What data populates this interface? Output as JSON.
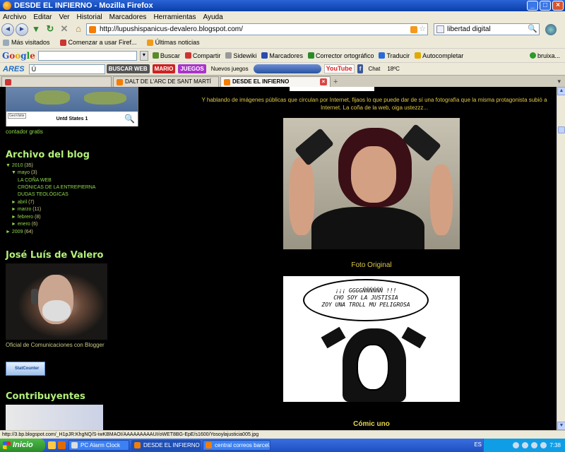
{
  "window": {
    "title": "DESDE EL INFIERNO - Mozilla Firefox",
    "buttons": {
      "minimize": "_",
      "maximize": "□",
      "close": "×"
    }
  },
  "menu": [
    "Archivo",
    "Editar",
    "Ver",
    "Historial",
    "Marcadores",
    "Herramientas",
    "Ayuda"
  ],
  "navigation": {
    "url": "http://lupushispanicus-devalero.blogspot.com/",
    "search_value": "libertad digital"
  },
  "bookmarks": [
    "Más visitados",
    "Comenzar a usar Firef...",
    "Últimas noticias"
  ],
  "google_toolbar": {
    "logo": "Google",
    "items": [
      "Buscar",
      "Compartir",
      "Sidewiki",
      "Marcadores",
      "Corrector ortográfico",
      "Traducir",
      "Autocompletar"
    ],
    "user": "bruixa..."
  },
  "ares_toolbar": {
    "logo": "ARES",
    "input": "Ú",
    "buttons": [
      "BUSCAR WEB",
      "MARIO",
      "JUEGOS",
      "Nuevos juegos"
    ],
    "chat": "Chat",
    "temp": "18ºC",
    "youtube": "YouTube"
  },
  "tabs": [
    {
      "label": "",
      "active": false
    },
    {
      "label": "DALT DE L'ARC DE SANT MARTÍ",
      "active": false
    },
    {
      "label": "DESDE EL INFIERNO",
      "active": true
    }
  ],
  "sidebar": {
    "map_label": "Untd States 1",
    "geovisite": "GeoVisite",
    "contador": "contador gratis",
    "archive_heading": "Archivo del blog",
    "archive": [
      {
        "toggle": "▼",
        "label": "2010",
        "count": "(35)",
        "level": 0
      },
      {
        "toggle": "▼",
        "label": "mayo",
        "count": "(3)",
        "level": 1
      },
      {
        "toggle": "",
        "label": "LA COÑA WEB",
        "count": "",
        "level": 2
      },
      {
        "toggle": "",
        "label": "CRÓNICAS DE LA ENTREPIERNA",
        "count": "",
        "level": 2
      },
      {
        "toggle": "",
        "label": "DUDAS TEOLÓGICAS",
        "count": "",
        "level": 2
      },
      {
        "toggle": "►",
        "label": "abril",
        "count": "(7)",
        "level": 1
      },
      {
        "toggle": "►",
        "label": "marzo",
        "count": "(11)",
        "level": 1
      },
      {
        "toggle": "►",
        "label": "febrero",
        "count": "(8)",
        "level": 1
      },
      {
        "toggle": "►",
        "label": "enero",
        "count": "(6)",
        "level": 1
      },
      {
        "toggle": "►",
        "label": "2009",
        "count": "(64)",
        "level": 0
      }
    ],
    "profile_heading": "José Luís de Valero",
    "profile_caption": "Oficial de Comunicaciones con Blogger",
    "statcounter": "StatCounter",
    "contrib_heading": "Contribuyentes"
  },
  "main": {
    "intro": "Y hablando de imágenes públicas que circulan por Internet, fijaos lo que puede dar de sí una fotografía que la misma protagonista subió a Internet. La coña de la web, oiga ustezzz...",
    "photo_caption": "Foto Original",
    "bubble_lines": [
      "¡¡¡ GGGGÑÑÑÑÑÑ !!!",
      "CHO SOY LA JUSTISIA",
      "ZOY UNA TROLL MU PELIGROSA"
    ],
    "comic_caption": "Cómic uno"
  },
  "status_text": "http://3.bp.blogspot.com/_H1pJR:KhgNQ/S-iwKBMAOI/AAAAAAAAAUI/oWET8BG-EpE/s1600/Yosoylajusticia005.jpg",
  "taskbar": {
    "start": "Inicio",
    "tasks": [
      "PC Alarm Clock",
      "DESDE EL INFIERNO ...",
      "central correos barcel..."
    ],
    "lang": "ES",
    "time": "7:38"
  }
}
